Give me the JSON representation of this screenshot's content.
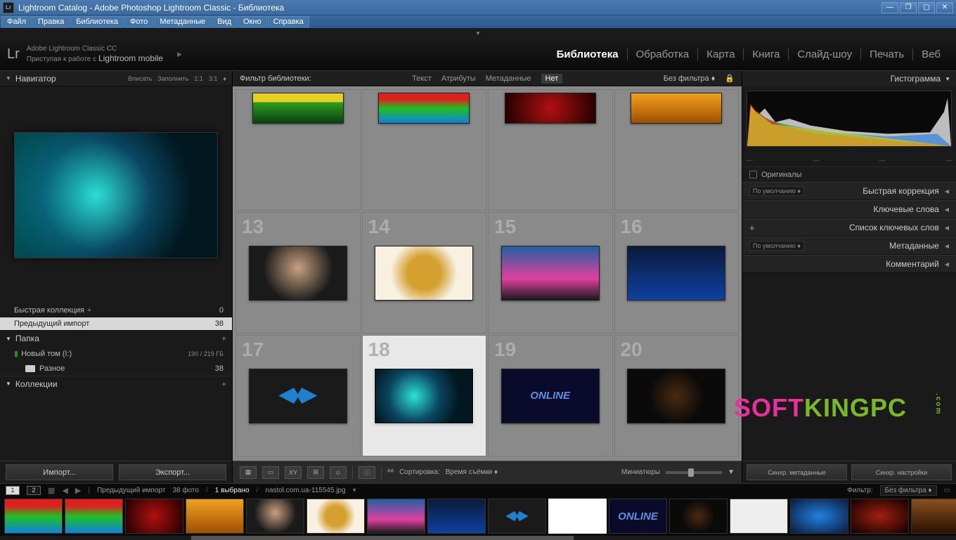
{
  "window": {
    "icon": "Lr",
    "title": "Lightroom Catalog - Adobe Photoshop Lightroom Classic - Библиотека"
  },
  "menu": [
    "Файл",
    "Правка",
    "Библиотека",
    "Фото",
    "Метаданные",
    "Вид",
    "Окно",
    "Справка"
  ],
  "header": {
    "logo": "Lr",
    "line1": "Adobe Lightroom Classic CC",
    "line2_prefix": "Приступая к работе с ",
    "line2_mobile": "Lightroom mobile",
    "modules": [
      "Библиотека",
      "Обработка",
      "Карта",
      "Книга",
      "Слайд-шоу",
      "Печать",
      "Веб"
    ],
    "active_module": 0
  },
  "navigator": {
    "title": "Навигатор",
    "opts": [
      "Вписать",
      "Заполнить",
      "1:1",
      "3:1"
    ]
  },
  "catalog": {
    "quick": {
      "label": "Быстрая коллекция",
      "count": "0"
    },
    "prev_import": {
      "label": "Предыдущий импорт",
      "count": "38"
    },
    "folder_hdr": "Папка",
    "volume": {
      "label": "Новый том (I:)",
      "size": "190 / 219 ГБ"
    },
    "subfolder": {
      "label": "Разное",
      "count": "38"
    },
    "collections_hdr": "Коллекции"
  },
  "left_buttons": {
    "import": "Импорт...",
    "export": "Экспорт..."
  },
  "filter": {
    "label": "Фильтр библиотеки:",
    "opts": [
      "Текст",
      "Атрибуты",
      "Метаданные",
      "Нет"
    ],
    "active": 3,
    "nofilter": "Без фильтра"
  },
  "grid_numbers": [
    "13",
    "14",
    "15",
    "16",
    "17",
    "18",
    "19",
    "20"
  ],
  "toolbar": {
    "sort_label": "Сортировка:",
    "sort_value": "Время съёмки",
    "thumbs_label": "Миниатюры"
  },
  "right": {
    "histogram": "Гистограмма",
    "originals": "Оригиналы",
    "default_dd": "По умолчанию",
    "panels": [
      "Быстрая коррекция",
      "Ключевые слова",
      "Список ключевых слов",
      "Метаданные",
      "Комментарий"
    ],
    "sync_meta": "Синхр. метаданные",
    "sync_settings": "Синхр. настройки"
  },
  "filmstrip": {
    "prev_import": "Предыдущий импорт",
    "count": "38 фото",
    "selected": "1 выбрано",
    "filename": "nastol.com.ua-115545.jpg",
    "filter_label": "Фильтр:",
    "filter_value": "Без фильтра"
  },
  "watermark": {
    "p1": "SOFT",
    "p2": "KINGPC",
    "dot": ".com"
  }
}
